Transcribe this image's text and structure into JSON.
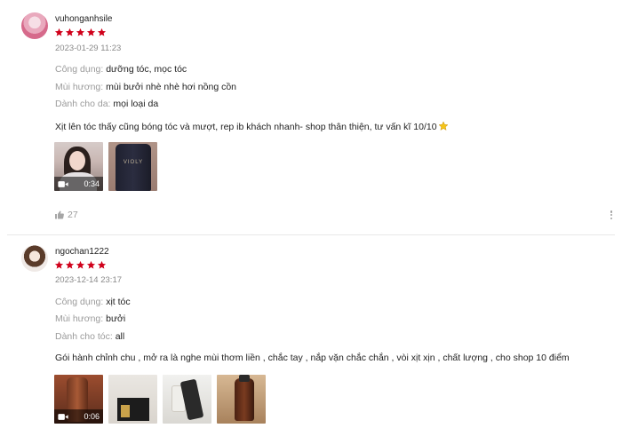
{
  "colors": {
    "star": "#d0011b",
    "accent_star_emoji": "#f5c518",
    "muted": "#9b9b9b"
  },
  "reviews": [
    {
      "username": "vuhonganhsile",
      "rating": 5,
      "timestamp": "2023-01-29 11:23",
      "attributes": [
        {
          "label": "Công dụng:",
          "value": "dưỡng tóc, mọc tóc"
        },
        {
          "label": "Mùi hương:",
          "value": "mùi bưởi nhè nhè hơi nồng cồn"
        },
        {
          "label": "Dành cho da:",
          "value": "mọi loại da"
        }
      ],
      "comment": "Xịt lên tóc thấy cũng bóng tóc và mượt, rep ib khách nhanh- shop thân thiện, tư vấn kĩ 10/10",
      "comment_emoji": "star-emoji-icon",
      "media": [
        {
          "type": "video",
          "duration": "0:34"
        },
        {
          "type": "image",
          "label_text": "VIOLY"
        }
      ],
      "likes": "27"
    },
    {
      "username": "ngochan1222",
      "rating": 5,
      "timestamp": "2023-12-14 23:17",
      "attributes": [
        {
          "label": "Công dụng:",
          "value": "xịt tóc"
        },
        {
          "label": "Mùi hương:",
          "value": "bưởi"
        },
        {
          "label": "Dành cho tóc:",
          "value": "all"
        }
      ],
      "comment": "Gói hành chỉnh chu , mở ra là nghe mùi thơm liền , chắc tay , nắp vặn chắc chắn , vòi xịt xịn , chất lượng , cho shop 10 điểm",
      "media": [
        {
          "type": "video",
          "duration": "0:06"
        },
        {
          "type": "image"
        },
        {
          "type": "image"
        },
        {
          "type": "image"
        }
      ]
    }
  ]
}
